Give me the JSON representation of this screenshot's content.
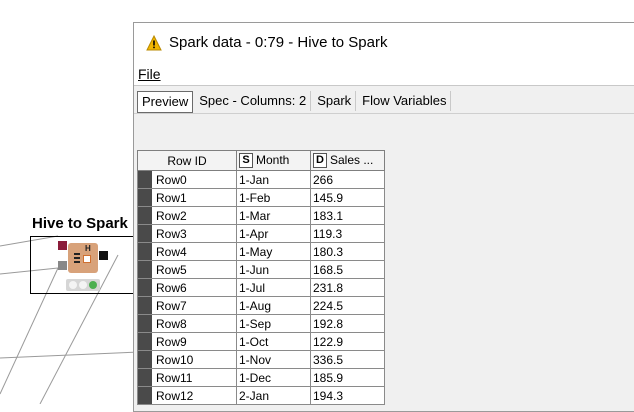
{
  "node": {
    "title": "Hive to Spark",
    "icon_letter": "H",
    "status_lights": [
      "off",
      "off",
      "green"
    ],
    "colors": {
      "icon": "#d8a27a",
      "port_in": "#8b1c3a",
      "ok": "#4caf50"
    }
  },
  "window": {
    "title": "Spark data - 0:79 - Hive to Spark",
    "title_icon": "warning-icon",
    "menu": {
      "file_label": "File"
    },
    "tabs": [
      {
        "label": "Preview",
        "active": true
      },
      {
        "label": "Spec - Columns: 2",
        "active": false
      },
      {
        "label": "Spark",
        "active": false
      },
      {
        "label": "Flow Variables",
        "active": false
      }
    ]
  },
  "table": {
    "headers": {
      "rowid": "Row ID",
      "month": {
        "type": "S",
        "label": "Month"
      },
      "sales": {
        "type": "D",
        "label": "Sales ..."
      }
    },
    "rows": [
      {
        "id": "Row0",
        "month": "1-Jan",
        "sales": "266"
      },
      {
        "id": "Row1",
        "month": "1-Feb",
        "sales": "145.9"
      },
      {
        "id": "Row2",
        "month": "1-Mar",
        "sales": "183.1"
      },
      {
        "id": "Row3",
        "month": "1-Apr",
        "sales": "119.3"
      },
      {
        "id": "Row4",
        "month": "1-May",
        "sales": "180.3"
      },
      {
        "id": "Row5",
        "month": "1-Jun",
        "sales": "168.5"
      },
      {
        "id": "Row6",
        "month": "1-Jul",
        "sales": "231.8"
      },
      {
        "id": "Row7",
        "month": "1-Aug",
        "sales": "224.5"
      },
      {
        "id": "Row8",
        "month": "1-Sep",
        "sales": "192.8"
      },
      {
        "id": "Row9",
        "month": "1-Oct",
        "sales": "122.9"
      },
      {
        "id": "Row10",
        "month": "1-Nov",
        "sales": "336.5"
      },
      {
        "id": "Row11",
        "month": "1-Dec",
        "sales": "185.9"
      },
      {
        "id": "Row12",
        "month": "2-Jan",
        "sales": "194.3"
      }
    ]
  }
}
